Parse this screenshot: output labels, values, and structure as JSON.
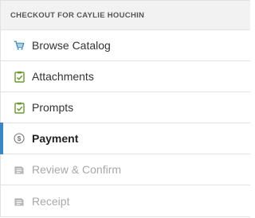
{
  "panel": {
    "title": "CHECKOUT FOR CAYLIE HOUCHIN"
  },
  "steps": [
    {
      "label": "Browse Catalog",
      "icon": "shopping-cart-icon",
      "state": "done"
    },
    {
      "label": "Attachments",
      "icon": "clipboard-check-icon",
      "state": "done"
    },
    {
      "label": "Prompts",
      "icon": "clipboard-check-icon",
      "state": "done"
    },
    {
      "label": "Payment",
      "icon": "dollar-circle-icon",
      "state": "active"
    },
    {
      "label": "Review & Confirm",
      "icon": "document-icon",
      "state": "disabled"
    },
    {
      "label": "Receipt",
      "icon": "document-icon",
      "state": "disabled"
    }
  ],
  "colors": {
    "accent": "#3a87c8",
    "cart": "#3a87c8",
    "check": "#6a9a2e",
    "disabled": "#a8a8a8"
  }
}
